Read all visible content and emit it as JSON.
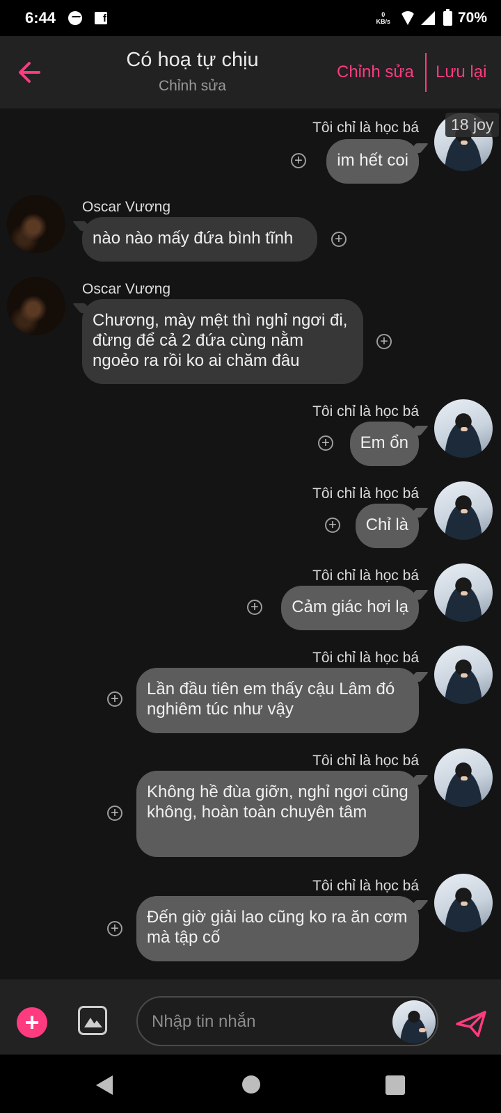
{
  "status_bar": {
    "time": "6:44",
    "net_speed_value": "0",
    "net_speed_unit": "KB/s",
    "battery": "70%",
    "fb_letter": "f"
  },
  "header": {
    "title": "Có hoạ tự chịu",
    "subtitle": "Chỉnh sửa",
    "edit_label": "Chỉnh sửa",
    "save_label": "Lưu lại"
  },
  "count_badge": "18 joy",
  "messages": [
    {
      "sender": "Tôi chỉ là học bá",
      "text": "im hết coi",
      "side": "me"
    },
    {
      "sender": "Oscar Vương",
      "text": "nào nào mấy đứa bình tĩnh",
      "side": "oscar"
    },
    {
      "sender": "Oscar Vương",
      "text": "Chương, mày mệt thì nghỉ ngơi đi, đừng để cả 2 đứa cùng nằm ngoẻo ra rồi ko ai chăm đâu",
      "side": "oscar"
    },
    {
      "sender": "Tôi chỉ là học bá",
      "text": "Em ổn",
      "side": "me"
    },
    {
      "sender": "Tôi chỉ là học bá",
      "text": "Chỉ là",
      "side": "me"
    },
    {
      "sender": "Tôi chỉ là học bá",
      "text": "Cảm giác hơi lạ",
      "side": "me"
    },
    {
      "sender": "Tôi chỉ là học bá",
      "text": "Lần đầu tiên em thấy cậu Lâm đó nghiêm túc như vậy",
      "side": "me"
    },
    {
      "sender": "Tôi chỉ là học bá",
      "text": "Không hề đùa giỡn, nghỉ ngơi cũng không, hoàn toàn chuyên tâm",
      "side": "me"
    },
    {
      "sender": "Tôi chỉ là học bá",
      "text": "Đến giờ giải lao cũng ko ra ăn cơm mà tập cố",
      "side": "me"
    }
  ],
  "input": {
    "placeholder": "Nhập tin nhắn"
  },
  "icons": {
    "back": "arrow-left-icon",
    "add": "plus-icon",
    "image": "image-icon",
    "send": "send-icon",
    "reaction": "add-circle-icon"
  },
  "colors": {
    "accent": "#ff3b7f",
    "bubble_me": "#5c5c5c",
    "bubble_other": "#373737",
    "background": "#141414"
  }
}
